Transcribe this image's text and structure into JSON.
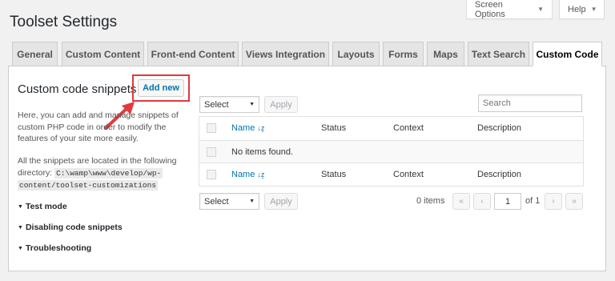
{
  "page_title": "Toolset Settings",
  "top_buttons": {
    "screen_options": "Screen Options",
    "help": "Help"
  },
  "tabs": [
    "General",
    "Custom Content",
    "Front-end Content",
    "Views Integration",
    "Layouts",
    "Forms",
    "Maps",
    "Text Search",
    "Custom Code"
  ],
  "active_tab": "Custom Code",
  "sidebar": {
    "title": "Custom code snippets",
    "add_new": "Add new",
    "intro": "Here, you can add and manage snippets of custom PHP code in order to modify the features of your site more easily.",
    "location_text": "All the snippets are located in the following directory:",
    "directory_line1": "C:\\wamp\\www\\develop/wp-",
    "directory_line2": "content/toolset-customizations",
    "sections": [
      "Test mode",
      "Disabling code snippets",
      "Troubleshooting"
    ]
  },
  "table": {
    "bulk_select": "Select",
    "apply": "Apply",
    "search_placeholder": "Search",
    "columns": {
      "name": "Name",
      "status": "Status",
      "context": "Context",
      "description": "Description"
    },
    "empty_message": "No items found.",
    "items_count": "0 items",
    "current_page": "1",
    "of_pages": "of 1",
    "pager": {
      "first": "«",
      "prev": "‹",
      "next": "›",
      "last": "»"
    }
  },
  "colors": {
    "accent": "#0073aa",
    "highlight": "#e03a3e"
  }
}
